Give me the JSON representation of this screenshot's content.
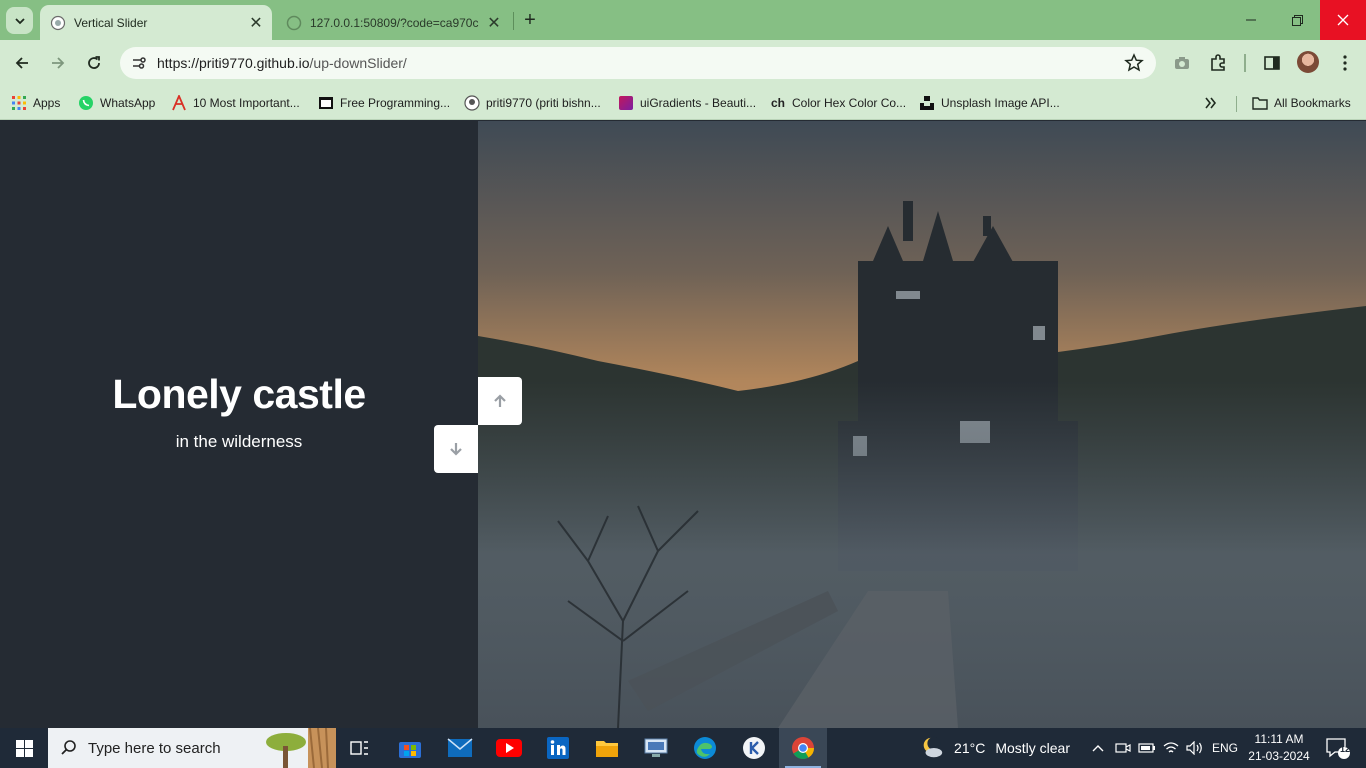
{
  "browser": {
    "tabs": [
      {
        "title": "Vertical Slider",
        "active": true
      },
      {
        "title": "127.0.0.1:50809/?code=ca970c",
        "active": false
      }
    ],
    "address": {
      "host": "https://priti9770.github.io",
      "path": "/up-downSlider/"
    },
    "bookmarks": [
      {
        "label": "Apps",
        "icon": "apps-grid-icon"
      },
      {
        "label": "WhatsApp",
        "icon": "whatsapp-icon"
      },
      {
        "label": "10 Most Important...",
        "icon": "arrow-logo-icon"
      },
      {
        "label": "Free Programming...",
        "icon": "book-icon"
      },
      {
        "label": "priti9770 (priti bishn...",
        "icon": "github-icon"
      },
      {
        "label": "uiGradients - Beauti...",
        "icon": "gradient-icon"
      },
      {
        "label": "Color Hex Color Co...",
        "icon": "ch-icon"
      },
      {
        "label": "Unsplash Image API...",
        "icon": "unsplash-icon"
      }
    ],
    "all_bookmarks": "All Bookmarks"
  },
  "slider": {
    "title": "Lonely castle",
    "subtitle": "in the wilderness",
    "left_bg": "#252b33",
    "image_subject": "misty castle at dusk"
  },
  "taskbar": {
    "search_placeholder": "Type here to search",
    "weather": {
      "temp": "21°C",
      "condition": "Mostly clear"
    },
    "language": "ENG",
    "time": "11:11 AM",
    "date": "21-03-2024",
    "notifications": "12"
  },
  "colors": {
    "tab_strip": "#86bf84",
    "toolbar": "#d4ead2",
    "taskbar": "#1f2a38"
  }
}
